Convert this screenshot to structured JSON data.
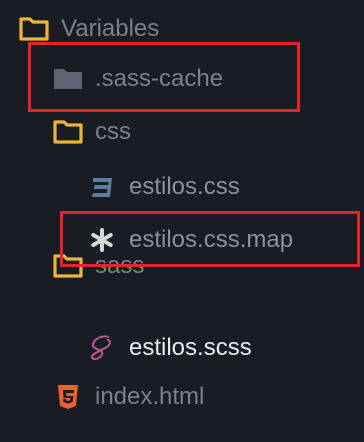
{
  "explorer": {
    "items": [
      {
        "label": "Variables",
        "kind": "folder-open",
        "icon": "folder-open-icon"
      },
      {
        "label": ".sass-cache",
        "kind": "folder-closed",
        "icon": "folder-icon"
      },
      {
        "label": "css",
        "kind": "folder-open",
        "icon": "folder-open-icon"
      },
      {
        "label": "estilos.css",
        "kind": "file",
        "icon": "css-file-icon"
      },
      {
        "label": "estilos.css.map",
        "kind": "file",
        "icon": "asterisk-icon"
      },
      {
        "label": "sass",
        "kind": "folder-open",
        "icon": "folder-open-icon"
      },
      {
        "label": "estilos.scss",
        "kind": "file",
        "icon": "sass-file-icon"
      },
      {
        "label": "index.html",
        "kind": "file",
        "icon": "html5-icon"
      }
    ]
  },
  "colors": {
    "background": "#191d23",
    "folder_outline": "#e9b53a",
    "closed_folder": "#5c6470",
    "css_icon": "#5d7ea0",
    "map_icon": "#d8d8d8",
    "sass_icon": "#b85a8f",
    "html_icon": "#e9622f",
    "highlight": "#e5242f"
  }
}
